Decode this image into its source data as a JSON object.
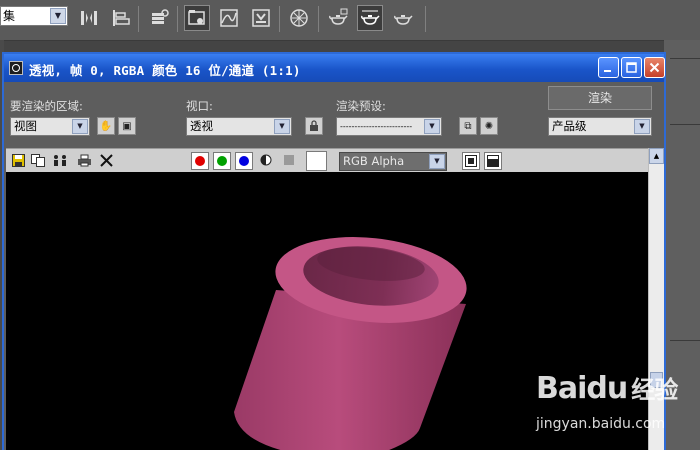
{
  "app_toolbar": {
    "set_dropdown_value": "集",
    "icons": [
      "mirror-icon",
      "align-icon",
      "layer-icon",
      "render-setup-icon",
      "curve-editor-icon",
      "render-frame-icon",
      "material-editor-icon",
      "render-teapot-icon",
      "active-render-teapot-icon",
      "quick-render-teapot-icon"
    ]
  },
  "render_window": {
    "title": "透视, 帧 0, RGBA 颜色 16 位/通道 (1:1)",
    "area_label": "要渲染的区域:",
    "area_value": "视图",
    "viewport_label": "视口:",
    "viewport_value": "透视",
    "preset_label": "渲染预设:",
    "preset_value": "-------------------------",
    "render_button": "渲染",
    "quality_value": "产品级",
    "channel_value": "RGB Alpha"
  },
  "colors": {
    "title_bar": "#1a55c9",
    "canvas": "#000000",
    "tube_light": "#c85a8a",
    "tube_dark": "#6e2a4a",
    "channel_red": "#e00000",
    "channel_green": "#00a000",
    "channel_blue": "#0000e0"
  },
  "watermark": {
    "logo": "Bai",
    "logo_suffix": "du",
    "logo_cn": "经验",
    "url": "jingyan.baidu.com"
  }
}
